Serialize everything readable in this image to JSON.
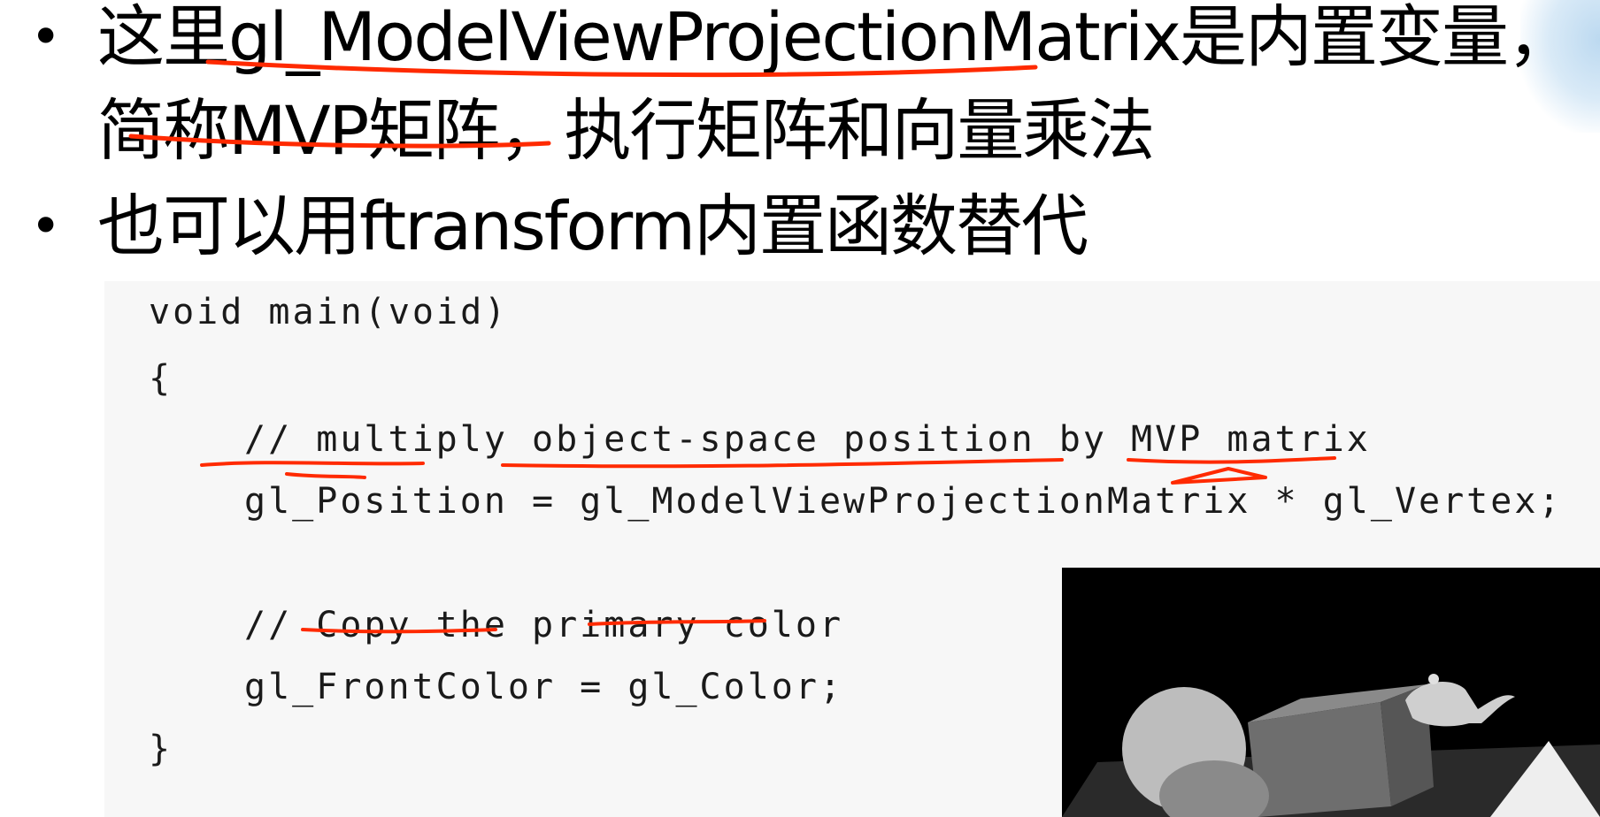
{
  "slide": {
    "bullets": [
      {
        "text": "这里gl_ModelViewProjectionMatrix是内置变量，"
      },
      {
        "text": "简称MVP矩阵，执行矩阵和向量乘法"
      },
      {
        "text": "也可以用ftransform内置函数替代"
      }
    ],
    "bullet_symbol": "•"
  },
  "code": {
    "lines": [
      "void main(void)",
      "{",
      "// multiply object-space position by MVP matrix",
      "gl_Position = gl_ModelViewProjectionMatrix * gl_Vertex;",
      "// Copy the primary color",
      "gl_FrontColor = gl_Color;",
      "}"
    ]
  },
  "colors": {
    "annotation": "#ff2a00",
    "text": "#000000",
    "code_bg": "#f7f7f7"
  }
}
